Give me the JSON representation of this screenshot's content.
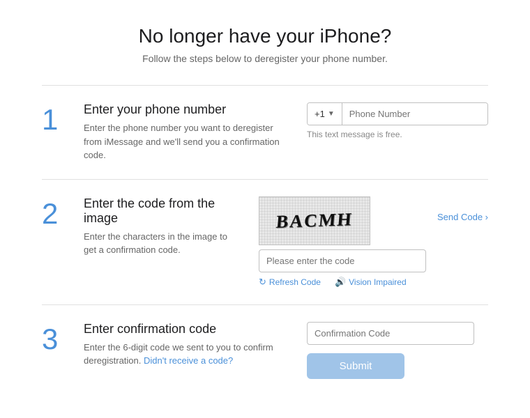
{
  "header": {
    "title": "No longer have your iPhone?",
    "subtitle": "Follow the steps below to deregister your phone number."
  },
  "steps": [
    {
      "number": "1",
      "title": "Enter your phone number",
      "description": "Enter the phone number you want to deregister from iMessage and we'll send you a confirmation code.",
      "country_code": "+1",
      "phone_placeholder": "Phone Number",
      "free_text": "This text message is free."
    },
    {
      "number": "2",
      "title": "Enter the code from the image",
      "description": "Enter the characters in the image to get a confirmation code.",
      "captcha_text": "BACMH",
      "code_placeholder": "Please enter the code",
      "send_code": "Send Code ›",
      "refresh_label": "Refresh Code",
      "vision_label": "Vision Impaired"
    },
    {
      "number": "3",
      "title": "Enter confirmation code",
      "description": "Enter the 6-digit code we sent to you to confirm deregistration.",
      "link_text": "Didn't receive a code?",
      "confirmation_placeholder": "Confirmation Code",
      "submit_label": "Submit"
    }
  ]
}
